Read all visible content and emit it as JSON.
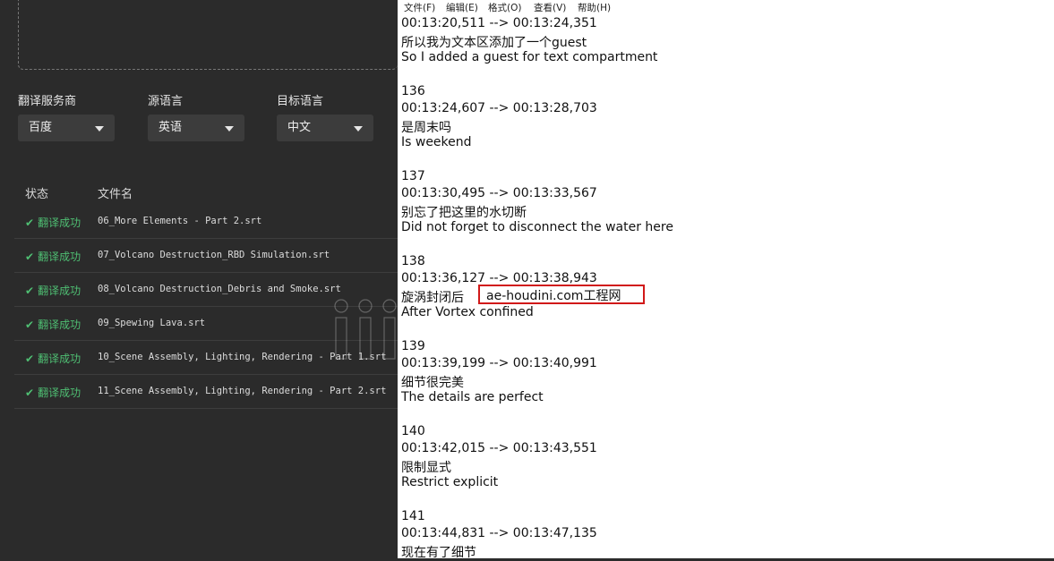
{
  "left_panel": {
    "dropzone_text": "",
    "service": {
      "label": "翻译服务商",
      "value": "百度"
    },
    "source_lang": {
      "label": "源语言",
      "value": "英语"
    },
    "target_lang": {
      "label": "目标语言",
      "value": "中文"
    },
    "table": {
      "headers": {
        "status": "状态",
        "filename": "文件名"
      },
      "rows": [
        {
          "status": "翻译成功",
          "filename": "06_More Elements - Part 2.srt"
        },
        {
          "status": "翻译成功",
          "filename": "07_Volcano Destruction_RBD Simulation.srt"
        },
        {
          "status": "翻译成功",
          "filename": "08_Volcano Destruction_Debris and Smoke.srt"
        },
        {
          "status": "翻译成功",
          "filename": "09_Spewing Lava.srt"
        },
        {
          "status": "翻译成功",
          "filename": "10_Scene Assembly, Lighting, Rendering - Part 1.srt"
        },
        {
          "status": "翻译成功",
          "filename": "11_Scene Assembly, Lighting, Rendering - Part 2.srt"
        }
      ]
    },
    "accent_color": "#4fbf73"
  },
  "notepad": {
    "menu": [
      "文件(F)",
      "编辑(E)",
      "格式(O)",
      "查看(V)",
      "帮助(H)"
    ],
    "lines": [
      "00:13:20,511 --> 00:13:24,351",
      "所以我为文本区添加了一个guest",
      "So I added a guest for text compartment",
      "",
      "136",
      "00:13:24,607 --> 00:13:28,703",
      "是周末吗",
      "Is weekend",
      "",
      "137",
      "00:13:30,495 --> 00:13:33,567",
      "别忘了把这里的水切断",
      "Did not forget to disconnect the water here",
      "",
      "138",
      "00:13:36,127 --> 00:13:38,943",
      "旋涡封闭后",
      "After Vortex confined",
      "",
      "139",
      "00:13:39,199 --> 00:13:40,991",
      "细节很完美",
      "The details are perfect",
      "",
      "140",
      "00:13:42,015 --> 00:13:43,551",
      "限制显式",
      "Restrict explicit",
      "",
      "141",
      "00:13:44,831 --> 00:13:47,135",
      "现在有了细节"
    ],
    "highlight_text": "ae-houdini.com工程网",
    "highlight_color": "#d11919"
  }
}
